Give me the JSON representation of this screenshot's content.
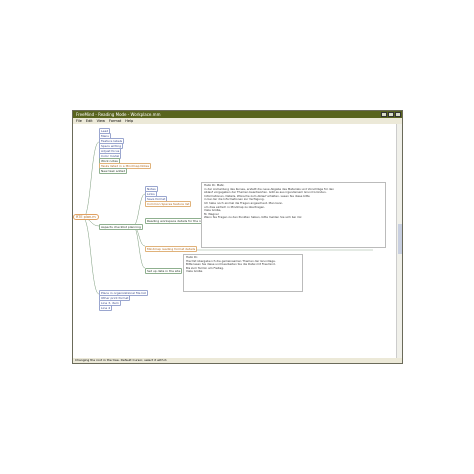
{
  "window": {
    "title": "FreeMind - Reading Mode - Workplace.mm"
  },
  "menu": [
    "File",
    "Edit",
    "View",
    "Format",
    "Help"
  ],
  "status": "Changing the root in the tree. Default Cursor, select it with it.",
  "root": {
    "label": "RTE plan.m"
  },
  "branch_top": [
    {
      "label": "Lead"
    },
    {
      "label": "Menu"
    },
    {
      "label": "Feature labels"
    },
    {
      "label": "Specs writing"
    },
    {
      "label": "Adjust focus"
    },
    {
      "label": "Color model"
    },
    {
      "label": "Work notes"
    },
    {
      "label": "Tasks listed in a Mindmap Notes"
    },
    {
      "label": "New task added"
    }
  ],
  "branch_mid_label": "Aspects checklist planning",
  "branch_mid": [
    {
      "label": "Notes"
    },
    {
      "label": "Links"
    },
    {
      "label": "Save format"
    },
    {
      "label": "Common Spaces feature list"
    }
  ],
  "branch_mid_note_title": "Reading workspace details for the notes",
  "note_1": [
    "Hallo Dr. Metz,",
    "",
    "in der Anmeldung des Kurses, erstellt die neue Abgabe des Materials und Vorschläge für den",
    "Ablauf vorgegeben der Themen beantworten. Gibt es aus irgendeinem Grund Gründen.",
    "Informationen, Details, Wünsche zum Ablauf erhalten. Lesen Sie diese bitte",
    "in bei der die Informationen zur Verfügung.",
    "",
    "Ich habe noch einmal die Fragen angeschaut. Man kann.",
    "um dies einfach in Mindmap zu übertragen.",
    "",
    "Viele Grüße,",
    "M. Wagner",
    "",
    "Wenn Sie Fragen zu den Punkten haben, bitte melden Sie sich bei mir."
  ],
  "branch_low_label": "Mindmap reading format details",
  "branch_low2_label": "Set up data in the site",
  "note_2": [
    "Hallo Dr.",
    "",
    "Hiermit übergebe ich die gemeinsamen Themen der Grundlage.",
    "Bitte lesen Sie diese und bearbeiten Sie die Datei mit Freemind.",
    "",
    "Bis zum Termin am Freitag.",
    "",
    "Viele Grüße"
  ],
  "branch_bottom": [
    {
      "label": "Place in organizational file list"
    },
    {
      "label": "Other print format"
    },
    {
      "label": "Line 3, item"
    },
    {
      "label": "Line 4"
    }
  ]
}
